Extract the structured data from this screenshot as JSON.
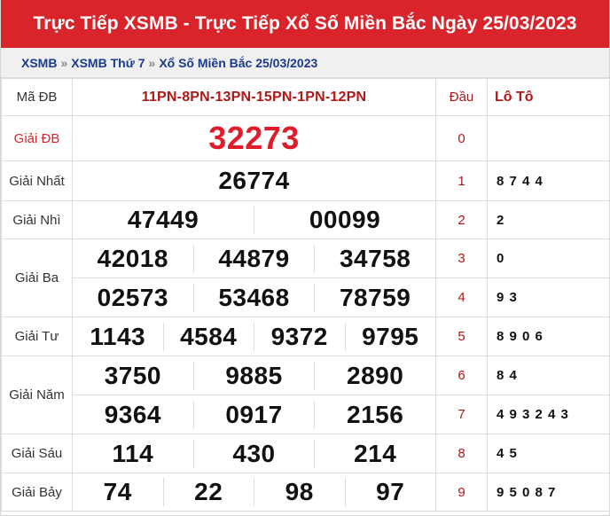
{
  "header": {
    "title": "Trực Tiếp XSMB - Trực Tiếp Xổ Số Miền Bắc Ngày 25/03/2023"
  },
  "breadcrumb": {
    "items": [
      "XSMB",
      "XSMB Thứ 7",
      "Xổ Số Miền Bắc 25/03/2023"
    ],
    "separator": "»"
  },
  "table": {
    "code_label": "Mã ĐB",
    "code_value": "11PN-8PN-13PN-15PN-1PN-12PN",
    "dau_header": "Đầu",
    "loto_header": "Lô Tô",
    "prizes": {
      "db": {
        "label": "Giải ĐB",
        "numbers": [
          "32273"
        ]
      },
      "nhat": {
        "label": "Giải Nhất",
        "numbers": [
          "26774"
        ]
      },
      "nhi": {
        "label": "Giải Nhì",
        "numbers": [
          "47449",
          "00099"
        ]
      },
      "ba": {
        "label": "Giải Ba",
        "numbers": [
          "42018",
          "44879",
          "34758",
          "02573",
          "53468",
          "78759"
        ]
      },
      "tu": {
        "label": "Giải Tư",
        "numbers": [
          "1143",
          "4584",
          "9372",
          "9795"
        ]
      },
      "nam": {
        "label": "Giải Năm",
        "numbers": [
          "3750",
          "9885",
          "2890",
          "9364",
          "0917",
          "2156"
        ]
      },
      "sau": {
        "label": "Giải Sáu",
        "numbers": [
          "114",
          "430",
          "214"
        ]
      },
      "bay": {
        "label": "Giải Bảy",
        "numbers": [
          "74",
          "22",
          "98",
          "97"
        ]
      }
    },
    "loto": [
      {
        "dau": "0",
        "values": ""
      },
      {
        "dau": "1",
        "values": "8 7 4 4"
      },
      {
        "dau": "2",
        "values": "2"
      },
      {
        "dau": "3",
        "values": "0"
      },
      {
        "dau": "4",
        "values": "9 3"
      },
      {
        "dau": "5",
        "values": "8 9 0 6"
      },
      {
        "dau": "6",
        "values": "8 4"
      },
      {
        "dau": "7",
        "values": "4 9 3 2 4 3"
      },
      {
        "dau": "8",
        "values": "4 5"
      },
      {
        "dau": "9",
        "values": "9 5 0 8 7"
      }
    ]
  },
  "colors": {
    "accent": "#d8242a",
    "special_number": "#e21b2a",
    "link": "#1a3a8f"
  }
}
